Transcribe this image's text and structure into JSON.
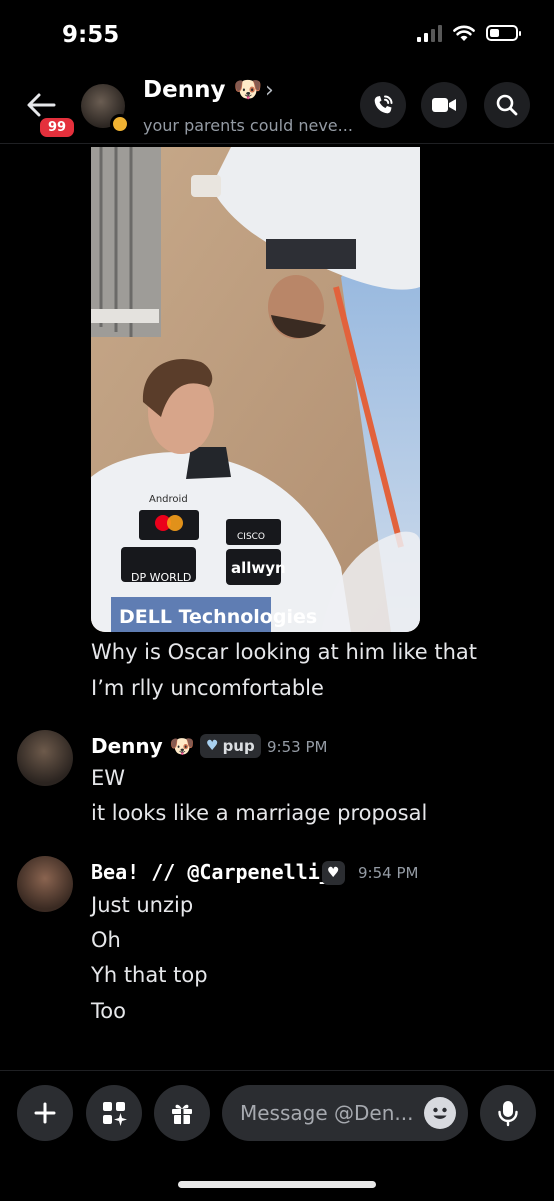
{
  "status": {
    "time": "9:55"
  },
  "header": {
    "badge": "99",
    "name": "Denny",
    "name_emoji": "🐶",
    "subtitle": "your parents could neve..."
  },
  "photo": {
    "sponsor_text": [
      "Android",
      "CISCO",
      "DP WORLD",
      "allwyn",
      "DELL Technologies"
    ]
  },
  "messages": [
    {
      "id": "continued",
      "lines": [
        "Why is Oscar looking at him like that",
        "I’m rlly uncomfortable"
      ]
    },
    {
      "id": "denny",
      "author": "Denny",
      "emoji": "🐶",
      "tag": "pup",
      "time": "9:53 PM",
      "lines": [
        "EW",
        "it looks like a marriage proposal"
      ]
    },
    {
      "id": "bea",
      "author": "Bea! // @Carpenelli_",
      "time": "9:54 PM",
      "lines": [
        "Just unzip",
        "Oh",
        "Yh that top",
        "Too"
      ]
    }
  ],
  "composer": {
    "placeholder": "Message @Den..."
  },
  "colors": {
    "background": "#000000",
    "surface": "#2b2d31",
    "badge": "#e4303c",
    "idle": "#f0b232"
  },
  "icons": [
    "back-arrow-icon",
    "call-icon",
    "video-icon",
    "search-icon",
    "plus-icon",
    "apps-icon",
    "gift-icon",
    "emoji-icon",
    "microphone-icon"
  ]
}
